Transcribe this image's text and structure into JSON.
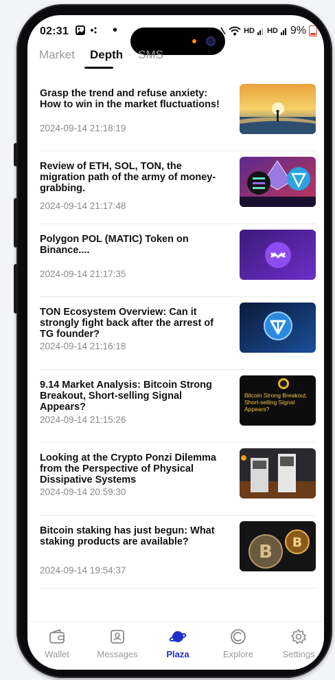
{
  "status_bar": {
    "time": "02:31",
    "battery": "9%",
    "network_labels": [
      "HD",
      "HD"
    ]
  },
  "tabs": [
    {
      "label": "Market",
      "active": false
    },
    {
      "label": "Depth",
      "active": true
    },
    {
      "label": "SMS",
      "active": false
    }
  ],
  "articles": [
    {
      "title": "Grasp the trend and refuse anxiety: How to win in the market fluctuations!",
      "date": "2024-09-14 21:18:19",
      "thumbnail": "sunset-silhouette-image"
    },
    {
      "title": "Review of ETH, SOL, TON, the migration path of the army of money-grabbing.",
      "date": "2024-09-14 21:17:48",
      "thumbnail": "crypto-coins-image"
    },
    {
      "title": "Polygon POL (MATIC) Token on Binance....",
      "date": "2024-09-14 21:17:35",
      "thumbnail": "polygon-logo-image"
    },
    {
      "title": "TON Ecosystem Overview: Can it strongly fight back after the arrest of TG founder?",
      "date": "2024-09-14 21:16:18",
      "thumbnail": "ton-logo-image"
    },
    {
      "title": "9.14 Market Analysis: Bitcoin Strong Breakout, Short-selling Signal Appears?",
      "date": "2024-09-14 21:15:26",
      "thumbnail": "bitcoin-analysis-image",
      "thumbnail_text": "Bitcoin Strong Breakout, Short-selling Signal Appears?"
    },
    {
      "title": "Looking at the Crypto Ponzi Dilemma from the Perspective of Physical Dissipative Systems",
      "date": "2024-09-14 20:59:30",
      "thumbnail": "crypto-atm-image"
    },
    {
      "title": "Bitcoin staking has just begun: What staking products are available?",
      "date": "2024-09-14 19:54:37",
      "thumbnail": "bitcoin-coins-image"
    }
  ],
  "bottom_nav": [
    {
      "label": "Wallet",
      "icon": "wallet-icon",
      "active": false
    },
    {
      "label": "Messages",
      "icon": "messages-icon",
      "active": false
    },
    {
      "label": "Plaza",
      "icon": "planet-icon",
      "active": true
    },
    {
      "label": "Explore",
      "icon": "explore-icon",
      "active": false
    },
    {
      "label": "Settings",
      "icon": "gear-icon",
      "active": false
    }
  ],
  "colors": {
    "accent": "#1f2ec8",
    "text_primary": "#111111",
    "text_secondary": "#8a8a8a"
  }
}
